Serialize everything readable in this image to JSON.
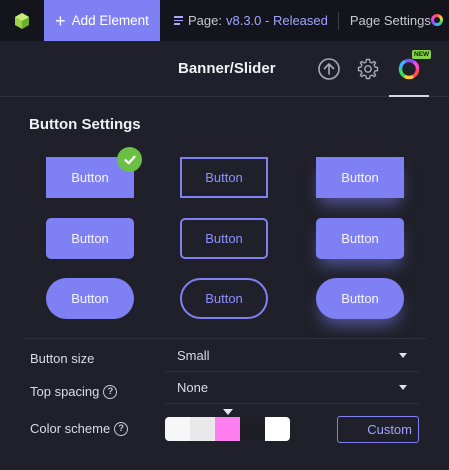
{
  "topbar": {
    "logo_icon": "cube-logo-icon",
    "add_element_label": "Add Element",
    "page_prefix": "Page:",
    "page_version": "v8.3.0 - Released",
    "page_settings_label": "Page Settings",
    "theme_icon": "color-wheel-icon"
  },
  "header": {
    "title": "Banner/Slider",
    "upload_icon": "upload-icon",
    "settings_icon": "gear-icon",
    "theme_icon": "color-wheel-icon",
    "new_badge": "NEW"
  },
  "button_settings": {
    "title": "Button Settings",
    "styles": [
      {
        "label": "Button",
        "variant": "filled",
        "shape": "square",
        "selected": true
      },
      {
        "label": "Button",
        "variant": "outline",
        "shape": "square",
        "selected": false
      },
      {
        "label": "Button",
        "variant": "glow",
        "shape": "square",
        "selected": false
      },
      {
        "label": "Button",
        "variant": "filled",
        "shape": "rounded",
        "selected": false
      },
      {
        "label": "Button",
        "variant": "outline",
        "shape": "rounded",
        "selected": false
      },
      {
        "label": "Button",
        "variant": "glow",
        "shape": "rounded",
        "selected": false
      },
      {
        "label": "Button",
        "variant": "filled",
        "shape": "pill",
        "selected": false
      },
      {
        "label": "Button",
        "variant": "outline",
        "shape": "pill",
        "selected": false
      },
      {
        "label": "Button",
        "variant": "glow",
        "shape": "pill",
        "selected": false
      }
    ]
  },
  "settings": {
    "button_size": {
      "label": "Button size",
      "value": "Small"
    },
    "top_spacing": {
      "label": "Top spacing",
      "value": "None"
    },
    "color_scheme": {
      "label": "Color scheme",
      "swatches": [
        "#f7f7f9",
        "#e9e9ec",
        "#ff7ef0",
        "#1d1e26",
        "#ffffff"
      ],
      "selected_index": 2,
      "custom_label": "Custom"
    }
  },
  "colors": {
    "accent": "#8080f5",
    "background": "#1f2029",
    "topbar": "#14151c",
    "check": "#6cbf45",
    "new_badge": "#86d34a"
  }
}
